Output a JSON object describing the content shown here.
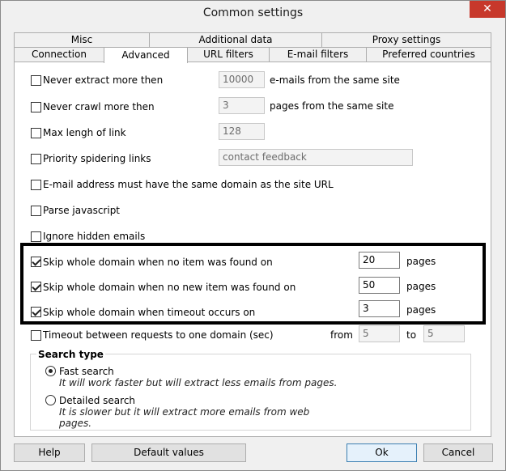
{
  "window": {
    "title": "Common settings",
    "close_glyph": "✕"
  },
  "tabs_back": [
    "Misc",
    "Additional data",
    "Proxy settings"
  ],
  "tabs_front": [
    "Connection",
    "Advanced",
    "URL filters",
    "E-mail filters",
    "Preferred countries"
  ],
  "active_tab": "Advanced",
  "options": {
    "never_extract": {
      "label": "Never extract more then",
      "value": "10000",
      "suffix": "e-mails from the same site",
      "checked": false
    },
    "never_crawl": {
      "label": "Never crawl more then",
      "value": "3",
      "suffix": "pages from the same site",
      "checked": false
    },
    "max_link": {
      "label": "Max lengh of link",
      "value": "128",
      "checked": false
    },
    "priority": {
      "label": "Priority spidering links",
      "value": "contact feedback",
      "checked": false
    },
    "same_domain": {
      "label": "E-mail address must have the same domain as the site URL",
      "checked": false
    },
    "parse_js": {
      "label": "Parse javascript",
      "checked": false
    },
    "ignore_hidden": {
      "label": "Ignore hidden emails",
      "checked": false
    },
    "skip_no_item": {
      "label": "Skip whole domain when no item was found on",
      "value": "20",
      "suffix": "pages",
      "checked": true
    },
    "skip_no_new": {
      "label": "Skip whole domain when no new item was found on",
      "value": "50",
      "suffix": "pages",
      "checked": true
    },
    "skip_timeout": {
      "label": "Skip whole domain when timeout occurs on",
      "value": "3",
      "suffix": "pages",
      "checked": true
    },
    "timeout_between": {
      "label": "Timeout between requests to one domain (sec)",
      "from_label": "from",
      "from_value": "5",
      "to_label": "to",
      "to_value": "5",
      "checked": false
    }
  },
  "search_type": {
    "title": "Search type",
    "fast": {
      "label": "Fast search",
      "desc": "It will work faster but will extract less emails from pages.",
      "selected": true
    },
    "detailed": {
      "label": "Detailed search",
      "desc1": "It is slower but it will extract more emails from web",
      "desc2": "pages.",
      "selected": false
    }
  },
  "buttons": {
    "help": "Help",
    "defaults": "Default values",
    "ok": "Ok",
    "cancel": "Cancel"
  }
}
